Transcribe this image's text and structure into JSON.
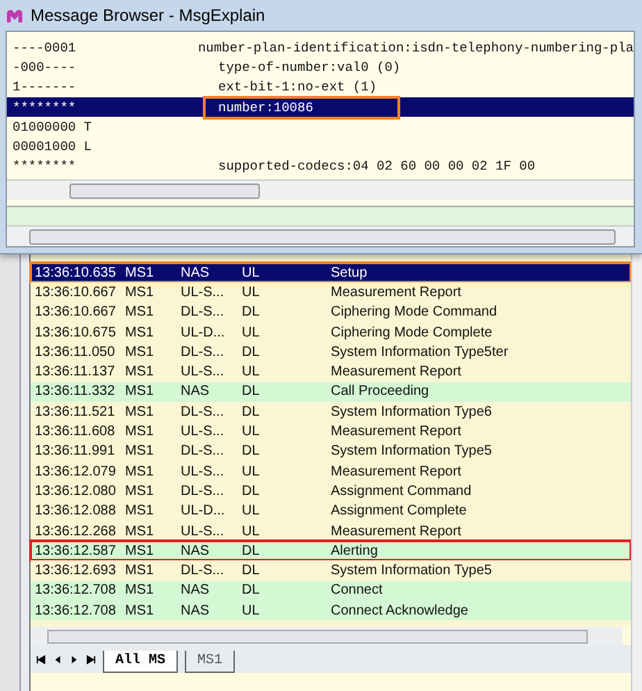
{
  "window": {
    "title": "Message Browser - MsgExplain"
  },
  "detail": {
    "rows": [
      {
        "bits": "----0001",
        "text": "number-plan-identification:isdn-telephony-numbering-pla",
        "selected": false
      },
      {
        "bits": "-000----",
        "text": "type-of-number:val0 (0)",
        "selected": false
      },
      {
        "bits": "1-------",
        "text": "ext-bit-1:no-ext (1)",
        "selected": false
      },
      {
        "bits": "********",
        "text": "number:10086",
        "selected": true,
        "box": {
          "color": "#f58220"
        }
      },
      {
        "bits": "01000000 T",
        "selected": false
      },
      {
        "bits": "00001000 L",
        "selected": false
      },
      {
        "bits": "********",
        "text": "supported-codecs:04 02 60 00 00 02 1F 00",
        "selected": false
      }
    ]
  },
  "messages": {
    "rows": [
      {
        "time": "13:36:10.635",
        "ms": "MS1",
        "layer": "NAS",
        "dir": "UL",
        "message": "Setup",
        "selected": true,
        "box": {
          "color": "#f58220"
        }
      },
      {
        "time": "13:36:10.667",
        "ms": "MS1",
        "layer": "UL-S...",
        "dir": "UL",
        "message": "Measurement Report",
        "selected": false,
        "color": "#faf5d2"
      },
      {
        "time": "13:36:10.667",
        "ms": "MS1",
        "layer": "DL-S...",
        "dir": "DL",
        "message": "Ciphering Mode Command",
        "selected": false,
        "color": "#faf5d2"
      },
      {
        "time": "13:36:10.675",
        "ms": "MS1",
        "layer": "UL-D...",
        "dir": "UL",
        "message": "Ciphering Mode Complete",
        "selected": false,
        "color": "#faf5d2"
      },
      {
        "time": "13:36:11.050",
        "ms": "MS1",
        "layer": "DL-S...",
        "dir": "DL",
        "message": "System Information Type5ter",
        "selected": false,
        "color": "#faf5d2"
      },
      {
        "time": "13:36:11.137",
        "ms": "MS1",
        "layer": "UL-S...",
        "dir": "UL",
        "message": "Measurement Report",
        "selected": false,
        "color": "#faf5d2"
      },
      {
        "time": "13:36:11.332",
        "ms": "MS1",
        "layer": "NAS",
        "dir": "DL",
        "message": "Call Proceeding",
        "selected": false,
        "color": "#d4f7d4"
      },
      {
        "time": "13:36:11.521",
        "ms": "MS1",
        "layer": "DL-S...",
        "dir": "DL",
        "message": "System Information Type6",
        "selected": false,
        "color": "#faf5d2"
      },
      {
        "time": "13:36:11.608",
        "ms": "MS1",
        "layer": "UL-S...",
        "dir": "UL",
        "message": "Measurement Report",
        "selected": false,
        "color": "#faf5d2"
      },
      {
        "time": "13:36:11.991",
        "ms": "MS1",
        "layer": "DL-S...",
        "dir": "DL",
        "message": "System Information Type5",
        "selected": false,
        "color": "#faf5d2"
      },
      {
        "time": "13:36:12.079",
        "ms": "MS1",
        "layer": "UL-S...",
        "dir": "UL",
        "message": "Measurement Report",
        "selected": false,
        "color": "#faf5d2"
      },
      {
        "time": "13:36:12.080",
        "ms": "MS1",
        "layer": "DL-S...",
        "dir": "DL",
        "message": "Assignment Command",
        "selected": false,
        "color": "#faf5d2"
      },
      {
        "time": "13:36:12.088",
        "ms": "MS1",
        "layer": "UL-D...",
        "dir": "UL",
        "message": "Assignment Complete",
        "selected": false,
        "color": "#faf5d2"
      },
      {
        "time": "13:36:12.268",
        "ms": "MS1",
        "layer": "UL-S...",
        "dir": "UL",
        "message": "Measurement Report",
        "selected": false,
        "color": "#faf5d2"
      },
      {
        "time": "13:36:12.587",
        "ms": "MS1",
        "layer": "NAS",
        "dir": "DL",
        "message": "Alerting",
        "selected": false,
        "color": "#d4f7d4",
        "box": {
          "color": "#e02020"
        }
      },
      {
        "time": "13:36:12.693",
        "ms": "MS1",
        "layer": "DL-S...",
        "dir": "DL",
        "message": "System Information Type5",
        "selected": false,
        "color": "#faf5d2"
      },
      {
        "time": "13:36:12.708",
        "ms": "MS1",
        "layer": "NAS",
        "dir": "DL",
        "message": "Connect",
        "selected": false,
        "color": "#d4f7d4"
      },
      {
        "time": "13:36:12.708",
        "ms": "MS1",
        "layer": "NAS",
        "dir": "UL",
        "message": "Connect Acknowledge",
        "selected": false,
        "color": "#d4f7d4"
      }
    ]
  },
  "tabs": [
    {
      "label": "All MS",
      "selected": true
    },
    {
      "label": "MS1",
      "selected": false
    }
  ]
}
